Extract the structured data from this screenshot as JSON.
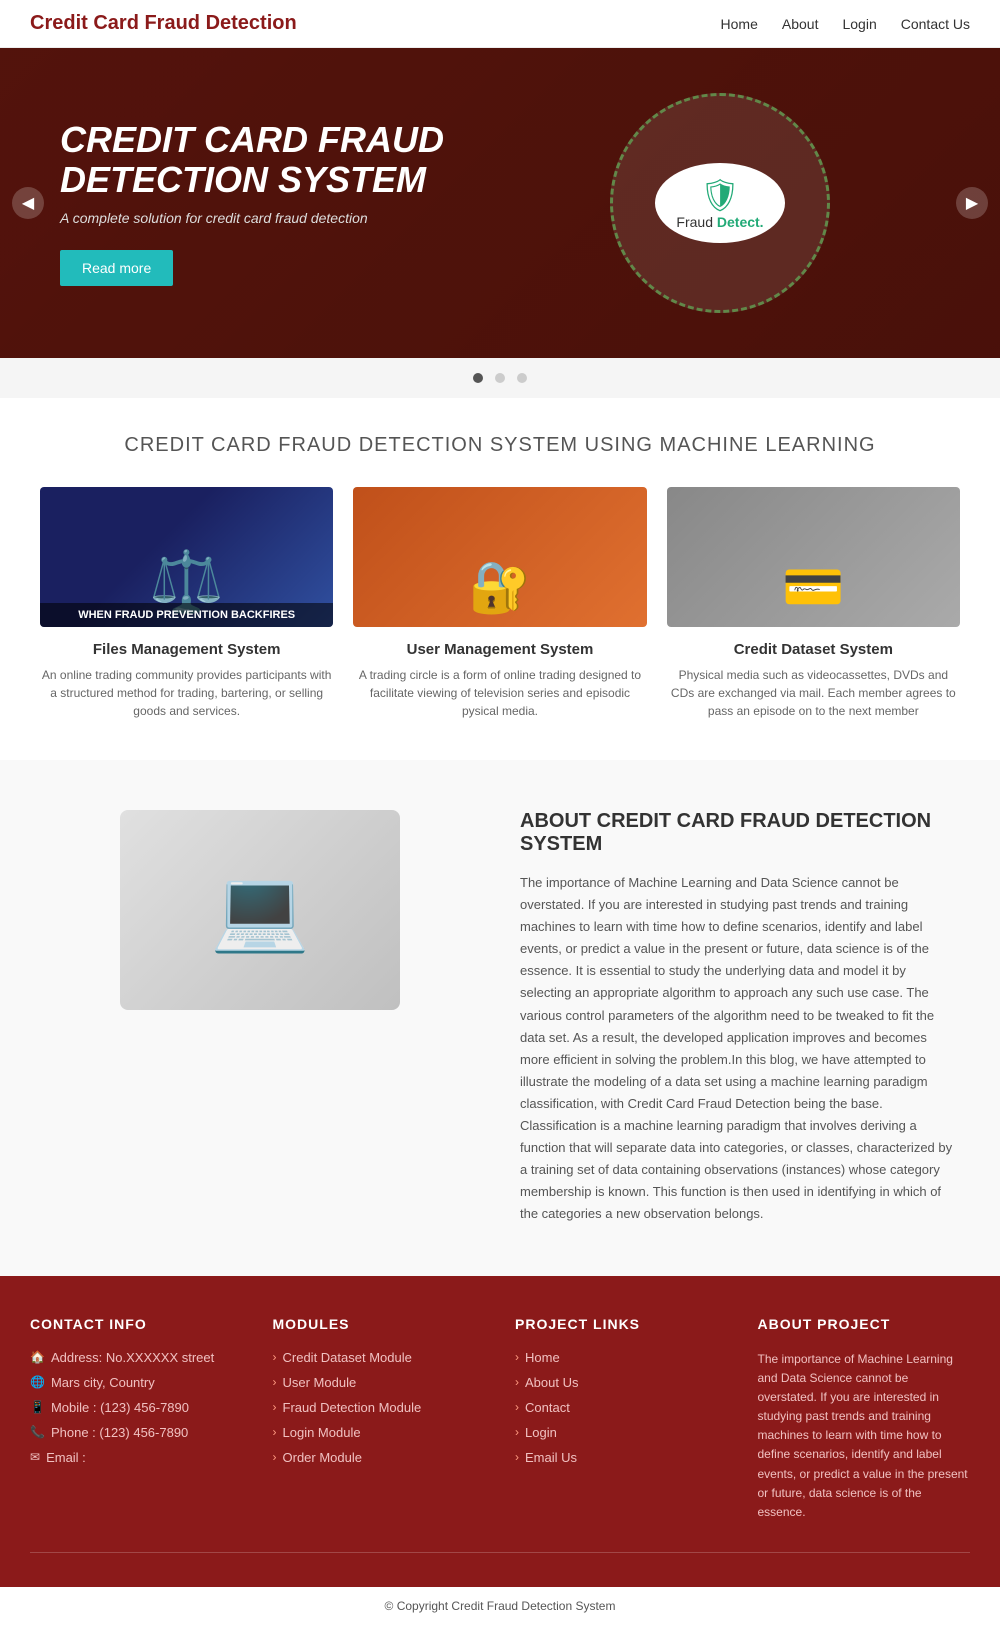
{
  "header": {
    "logo": "Credit Card Fraud Detection",
    "nav": [
      {
        "label": "Home",
        "href": "#"
      },
      {
        "label": "About",
        "href": "#"
      },
      {
        "label": "Login",
        "href": "#"
      },
      {
        "label": "Contact Us",
        "href": "#"
      }
    ]
  },
  "hero": {
    "title": "CREDIT CARD FRAUD DETECTION SYSTEM",
    "subtitle": "A complete solution for credit card fraud detection",
    "btn_label": "Read more",
    "fraud_detect_label": "Fraud Detect.",
    "carousel_dots": 3
  },
  "features_section": {
    "title": "CREDIT CARD FRAUD DETECTION SYSTEM USING MACHINE LEARNING",
    "cards": [
      {
        "img_label": "WHEN FRAUD PREVENTION BACKFIRES",
        "title": "Files Management System",
        "desc": "An online trading community provides participants with a structured method for trading, bartering, or selling goods and services."
      },
      {
        "img_label": "",
        "title": "User Management System",
        "desc": "A trading circle is a form of online trading designed to facilitate viewing of television series and episodic pysical media."
      },
      {
        "img_label": "",
        "title": "Credit Dataset System",
        "desc": "Physical media such as videocassettes, DVDs and CDs are exchanged via mail. Each member agrees to pass an episode on to the next member"
      }
    ]
  },
  "about": {
    "title": "ABOUT CREDIT CARD FRAUD DETECTION SYSTEM",
    "body": "The importance of Machine Learning and Data Science cannot be overstated. If you are interested in studying past trends and training machines to learn with time how to define scenarios, identify and label events, or predict a value in the present or future, data science is of the essence. It is essential to study the underlying data and model it by selecting an appropriate algorithm to approach any such use case. The various control parameters of the algorithm need to be tweaked to fit the data set. As a result, the developed application improves and becomes more efficient in solving the problem.In this blog, we have attempted to illustrate the modeling of a data set using a machine learning paradigm classification, with Credit Card Fraud Detection being the base. Classification is a machine learning paradigm that involves deriving a function that will separate data into categories, or classes, characterized by a training set of data containing observations (instances) whose category membership is known. This function is then used in identifying in which of the categories a new observation belongs."
  },
  "footer": {
    "contact_info": {
      "heading": "CONTACT INFO",
      "items": [
        {
          "icon": "🏠",
          "text": "Address: No.XXXXXX street"
        },
        {
          "icon": "🌐",
          "text": "Mars city, Country"
        },
        {
          "icon": "📱",
          "text": "Mobile : (123) 456-7890"
        },
        {
          "icon": "📞",
          "text": "Phone : (123) 456-7890"
        },
        {
          "icon": "✉",
          "text": "Email :"
        }
      ]
    },
    "modules": {
      "heading": "MODULES",
      "items": [
        "Credit Dataset Module",
        "User Module",
        "Fraud Detection Module",
        "Login Module",
        "Order Module"
      ]
    },
    "project_links": {
      "heading": "PROJECT LINKS",
      "items": [
        "Home",
        "About Us",
        "Contact",
        "Login",
        "Email Us"
      ]
    },
    "about_project": {
      "heading": "ABOUT PROJECT",
      "body": "The importance of Machine Learning and Data Science cannot be overstated. If you are interested in studying past trends and training machines to learn with time how to define scenarios, identify and label events, or predict a value in the present or future, data science is of the essence."
    },
    "copyright": "© Copyright Credit Fraud Detection System"
  }
}
